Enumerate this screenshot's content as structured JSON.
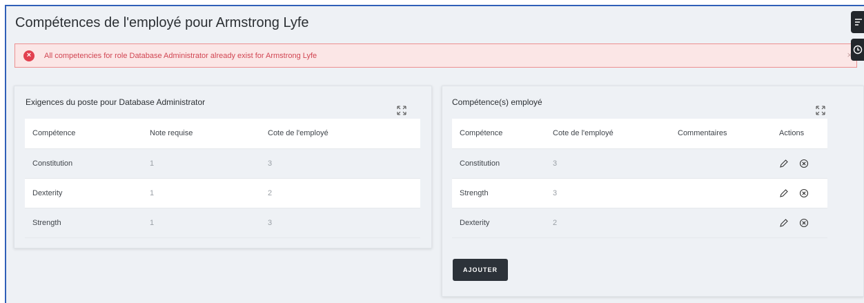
{
  "page": {
    "title": "Compétences de l'employé pour Armstrong Lyfe"
  },
  "alert": {
    "message": "All competencies for role Database Administrator already exist for Armstrong Lyfe",
    "icon": "error-circle-icon",
    "close": "×",
    "color": "#e2404f"
  },
  "left_card": {
    "title": "Exigences du poste pour Database Administrator",
    "columns": [
      "Compétence",
      "Note requise",
      "Cote de l'employé"
    ],
    "rows": [
      {
        "competence": "Constitution",
        "required": "1",
        "rating": "3"
      },
      {
        "competence": "Dexterity",
        "required": "1",
        "rating": "2"
      },
      {
        "competence": "Strength",
        "required": "1",
        "rating": "3"
      }
    ]
  },
  "right_card": {
    "title": "Compétence(s) employé",
    "columns": [
      "Compétence",
      "Cote de l'employé",
      "Commentaires",
      "Actions"
    ],
    "rows": [
      {
        "competence": "Constitution",
        "rating": "3",
        "comments": ""
      },
      {
        "competence": "Strength",
        "rating": "3",
        "comments": ""
      },
      {
        "competence": "Dexterity",
        "rating": "2",
        "comments": ""
      }
    ],
    "add_button": "AJOUTER"
  },
  "side_buttons": [
    "filter-list-icon",
    "clock-icon"
  ]
}
